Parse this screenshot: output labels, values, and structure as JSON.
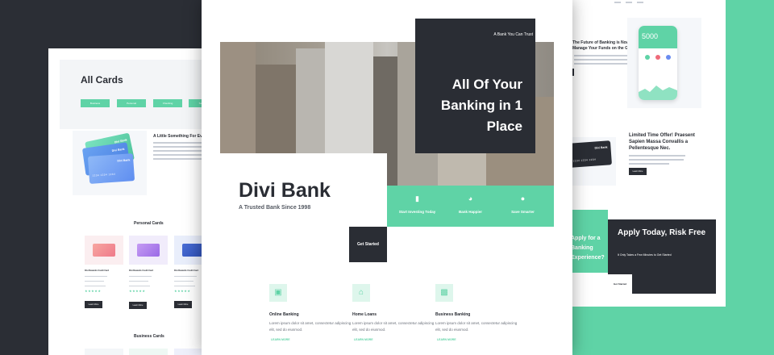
{
  "colors": {
    "teal": "#5fd3a6",
    "dark": "#2a2d34",
    "background": "#2b2e35"
  },
  "left_page": {
    "title": "All Cards",
    "hero_buttons": [
      "Business",
      "Personal",
      "Checking",
      "Savings"
    ],
    "card_brand": "Divi Bank",
    "card_number": "1234  1234  1234",
    "promo_heading": "A Little Something For Everyone",
    "personal_heading": "Personal Cards",
    "business_heading": "Business Cards",
    "product_name": "Divi Rewards Credit Card",
    "more_label": "Learn More",
    "stars": "★★★★★"
  },
  "right_page": {
    "heading": "The Future of Banking is Now. Manage Your Funds on the Go",
    "balance": "5000",
    "limited_offer": "Limited Time Offer! Praesent Sapien Massa Convallis a Pellentesque Nec.",
    "card_brand": "Divi Bank",
    "card_number": "1234  1234  1234",
    "learn_more": "Learn More",
    "teal_text": "Apply for a Banking Experience?",
    "apply_title": "Apply Today, Risk Free",
    "apply_sub": "It Only Takes a Few Minutes to Get Started",
    "get_started": "Get Started"
  },
  "center_page": {
    "tag": "A Bank You Can Trust",
    "headline": "All Of Your Banking in 1 Place",
    "brand": "Divi Bank",
    "tagline": "A Trusted Bank Since 1998",
    "cta": "Get Started",
    "features": [
      {
        "icon": "chart-icon",
        "label": "Start Investing Today"
      },
      {
        "icon": "pie-chart-icon",
        "label": "Bank Happier"
      },
      {
        "icon": "piggy-bank-icon",
        "label": "Save Smarter"
      }
    ],
    "services": [
      {
        "icon": "monitor-icon",
        "title": "Online Banking",
        "body": "Lorem ipsum dolor sit amet, consectetur adipiscing elit, sed do eiusmod.",
        "link": "LEARN MORE"
      },
      {
        "icon": "house-icon",
        "title": "Home Loans",
        "body": "Lorem ipsum dolor sit amet, consectetur adipiscing elit, sed do eiusmod.",
        "link": "LEARN MORE"
      },
      {
        "icon": "briefcase-icon",
        "title": "Business Banking",
        "body": "Lorem ipsum dolor sit amet, consectetur adipiscing elit, sed do eiusmod.",
        "link": "LEARN MORE"
      }
    ]
  }
}
